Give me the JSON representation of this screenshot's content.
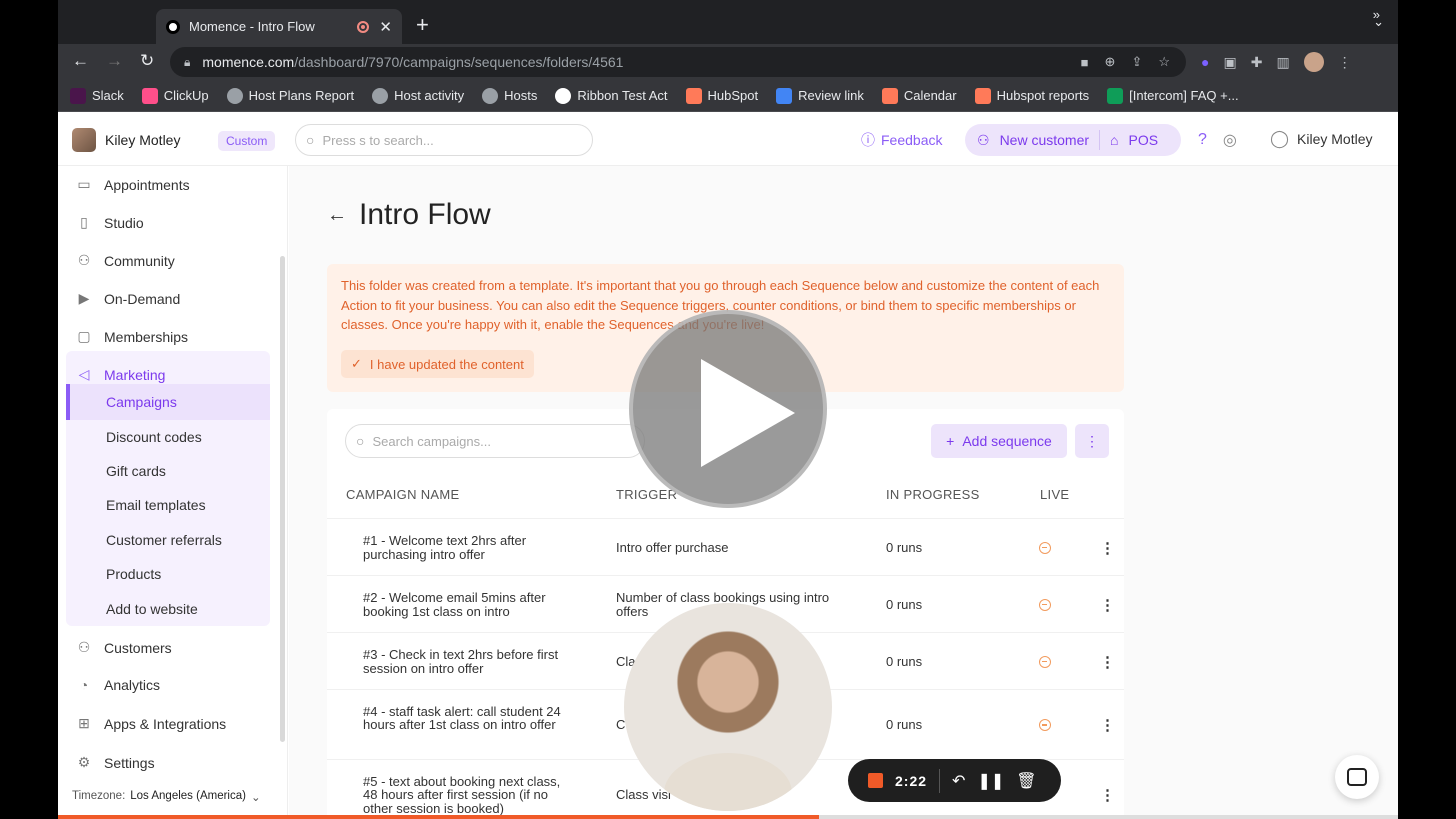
{
  "browser": {
    "tab_title": "Momence - Intro Flow",
    "new_tab": "+",
    "close": "✕",
    "url_host": "momence.com",
    "url_path": "/dashboard/7970/campaigns/sequences/folders/4561",
    "bookmarks": [
      {
        "label": "Slack",
        "color": "#4a154b"
      },
      {
        "label": "ClickUp",
        "color": "#ff4f8a"
      },
      {
        "label": "Host Plans Report",
        "color": "#9aa0a6"
      },
      {
        "label": "Host activity",
        "color": "#9aa0a6"
      },
      {
        "label": "Hosts",
        "color": "#9aa0a6"
      },
      {
        "label": "Ribbon Test Act",
        "color": "#ffffff"
      },
      {
        "label": "HubSpot",
        "color": "#ff7a59"
      },
      {
        "label": "Review link",
        "color": "#4285f4"
      },
      {
        "label": "Calendar",
        "color": "#ff7a59"
      },
      {
        "label": "Hubspot reports",
        "color": "#ff7a59"
      },
      {
        "label": "[Intercom] FAQ +...",
        "color": "#0f9d58"
      }
    ],
    "bookmarks_more": "»"
  },
  "header": {
    "account_name": "Kiley Motley",
    "plan_badge": "Custom",
    "search_placeholder": "Press s to search...",
    "feedback": "Feedback",
    "new_customer": "New customer",
    "pos": "POS",
    "user_name": "Kiley Motley"
  },
  "sidebar": {
    "items": [
      {
        "label": "Appointments",
        "icon": "calendar-icon",
        "glyph": "▭"
      },
      {
        "label": "Studio",
        "icon": "building-icon",
        "glyph": "▯"
      },
      {
        "label": "Community",
        "icon": "users-icon",
        "glyph": "⚇"
      },
      {
        "label": "On-Demand",
        "icon": "video-icon",
        "glyph": "▶"
      },
      {
        "label": "Memberships",
        "icon": "membership-icon",
        "glyph": "▢"
      },
      {
        "label": "Marketing",
        "icon": "megaphone-icon",
        "glyph": "◁"
      }
    ],
    "marketing_sub": [
      "Campaigns",
      "Discount codes",
      "Gift cards",
      "Email templates",
      "Customer referrals",
      "Products",
      "Add to website"
    ],
    "items_bottom": [
      {
        "label": "Customers",
        "icon": "customers-icon",
        "glyph": "⚇"
      },
      {
        "label": "Analytics",
        "icon": "chart-icon",
        "glyph": "◔"
      },
      {
        "label": "Apps & Integrations",
        "icon": "apps-icon",
        "glyph": "⊞"
      },
      {
        "label": "Settings",
        "icon": "gear-icon",
        "glyph": "⚙"
      }
    ],
    "timezone_label": "Timezone:",
    "timezone_value": "Los Angeles (America)"
  },
  "main": {
    "title": "Intro Flow",
    "notice": "This folder was created from a template. It's important that you go through each Sequence below and customize the content of each Action to fit your business. You can also edit the Sequence triggers, counter conditions, or bind them to specific memberships or classes. Once you're happy with it, enable the Sequences and you're live!",
    "notice_button": "I have updated the content",
    "search_placeholder": "Search campaigns...",
    "add_sequence": "Add sequence",
    "columns": [
      "CAMPAIGN NAME",
      "TRIGGER",
      "IN PROGRESS",
      "LIVE"
    ],
    "rows": [
      {
        "name": "#1 - Welcome text 2hrs after purchasing intro offer",
        "trigger": "Intro offer purchase",
        "progress": "0 runs"
      },
      {
        "name": "#2 - Welcome email 5mins after booking 1st class on intro",
        "trigger": "Number of class bookings using intro offers",
        "progress": "0 runs"
      },
      {
        "name": "#3 - Check in text 2hrs before first session on intro offer",
        "trigger": "Cla",
        "progress": "0 runs"
      },
      {
        "name": "#4 - staff task alert: call student 24 hours after 1st class on intro offer",
        "trigger": "C",
        "progress": "0 runs"
      },
      {
        "name": "#5 - text about booking next class, 48 hours after first session (if no other session is booked)",
        "trigger": "Class visi                          s",
        "progress": ""
      }
    ]
  },
  "recorder": {
    "time": "2:22",
    "progress": 0.568
  }
}
